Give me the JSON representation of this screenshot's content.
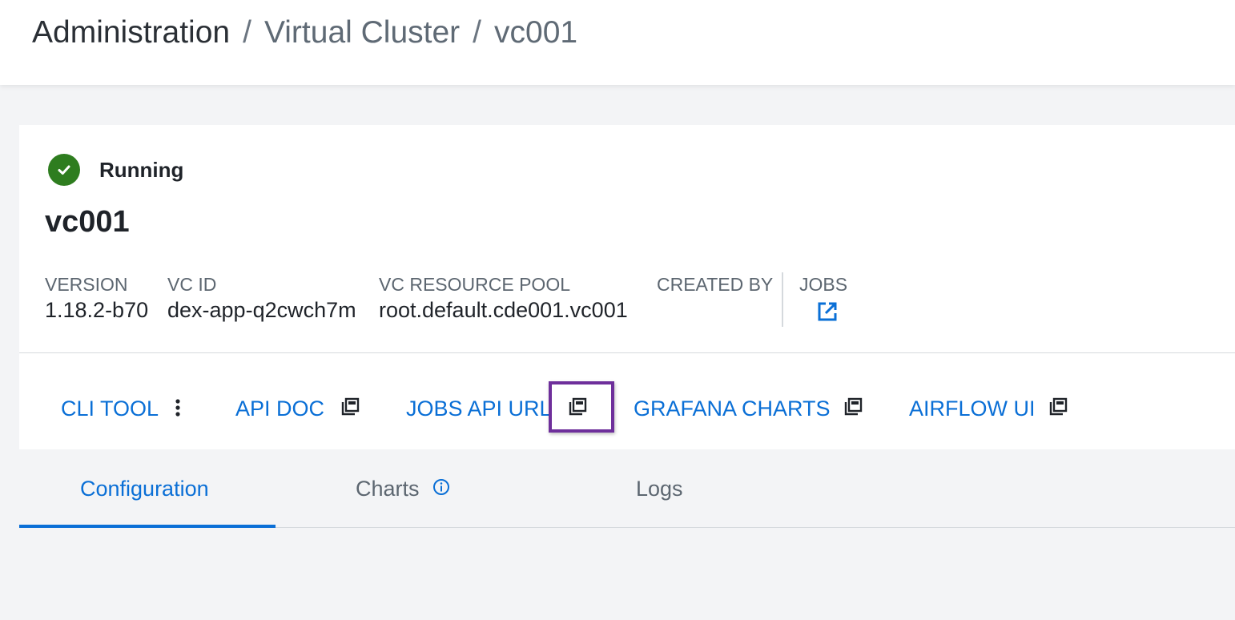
{
  "breadcrumb": {
    "items": [
      "Administration",
      "Virtual Cluster",
      "vc001"
    ],
    "separator": "/"
  },
  "status": {
    "label": "Running",
    "color": "#2e7d1f",
    "icon": "check-circle-icon"
  },
  "cluster": {
    "name": "vc001"
  },
  "meta": {
    "version_label": "VERSION",
    "version_value": "1.18.2-b70",
    "vc_id_label": "VC ID",
    "vc_id_value": "dex-app-q2cwch7m",
    "resource_pool_label": "VC RESOURCE POOL",
    "resource_pool_value": "root.default.cde001.vc001",
    "created_by_label": "CREATED BY",
    "created_by_value": "",
    "jobs_label": "JOBS",
    "jobs_icon": "external-link-icon"
  },
  "links": {
    "cli_tool": "CLI TOOL",
    "api_doc": "API DOC",
    "jobs_api_url": "JOBS API URL",
    "grafana_charts": "GRAFANA CHARTS",
    "airflow_ui": "AIRFLOW UI"
  },
  "tabs": {
    "configuration": "Configuration",
    "charts": "Charts",
    "logs": "Logs",
    "active": "Configuration"
  },
  "colors": {
    "accent": "#0a6fd6",
    "highlight_border": "#6e2f9b",
    "success": "#2e7d1f"
  }
}
